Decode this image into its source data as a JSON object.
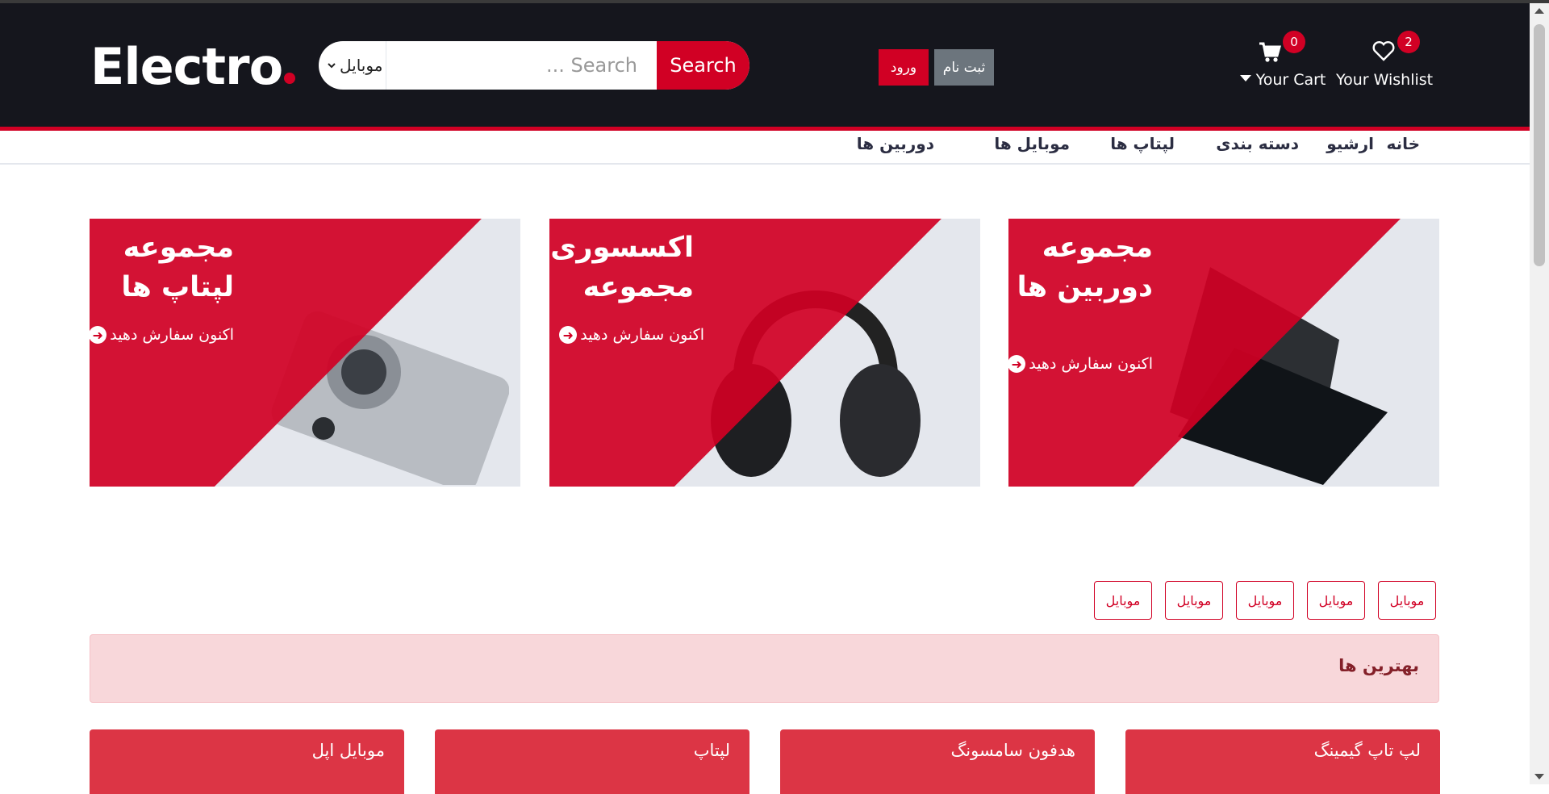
{
  "header": {
    "logo_text": "Electro",
    "search": {
      "category_selected": "موبایل",
      "placeholder": "Search ...",
      "button_label": "Search"
    },
    "login_label": "ورود",
    "register_label": "ثبت نام",
    "cart": {
      "label": "Your Cart",
      "count": "0"
    },
    "wishlist": {
      "label": "Your Wishlist",
      "count": "2"
    }
  },
  "nav": {
    "items": [
      {
        "label": "خانه"
      },
      {
        "label": "ارشیو"
      },
      {
        "label": "دسته بندی"
      },
      {
        "label": "لپتاپ ها"
      },
      {
        "label": "موبایل ها"
      },
      {
        "label": "دوربین ها"
      }
    ]
  },
  "banners": [
    {
      "title_line1": "مجموعه",
      "title_line2": "لپتاپ ها",
      "cta": "اکنون سفارش دهید"
    },
    {
      "title_line1": "اکسسوری ها",
      "title_line2": "مجموعه",
      "cta": "اکنون سفارش دهید"
    },
    {
      "title_line1": "مجموعه",
      "title_line2": "دوربین ها",
      "cta": "اکنون سفارش دهید"
    }
  ],
  "filters": [
    {
      "label": "موبایل"
    },
    {
      "label": "موبایل"
    },
    {
      "label": "موبایل"
    },
    {
      "label": "موبایل"
    },
    {
      "label": "موبایل"
    }
  ],
  "best_section": {
    "title": "بهترین ها"
  },
  "cards": [
    {
      "title": "لپ تاپ گیمینگ"
    },
    {
      "title": "هدفون سامسونگ"
    },
    {
      "title": "لپتاپ"
    },
    {
      "title": "موبایل اپل"
    }
  ],
  "colors": {
    "accent": "#d10024",
    "header_bg": "#15161d"
  }
}
